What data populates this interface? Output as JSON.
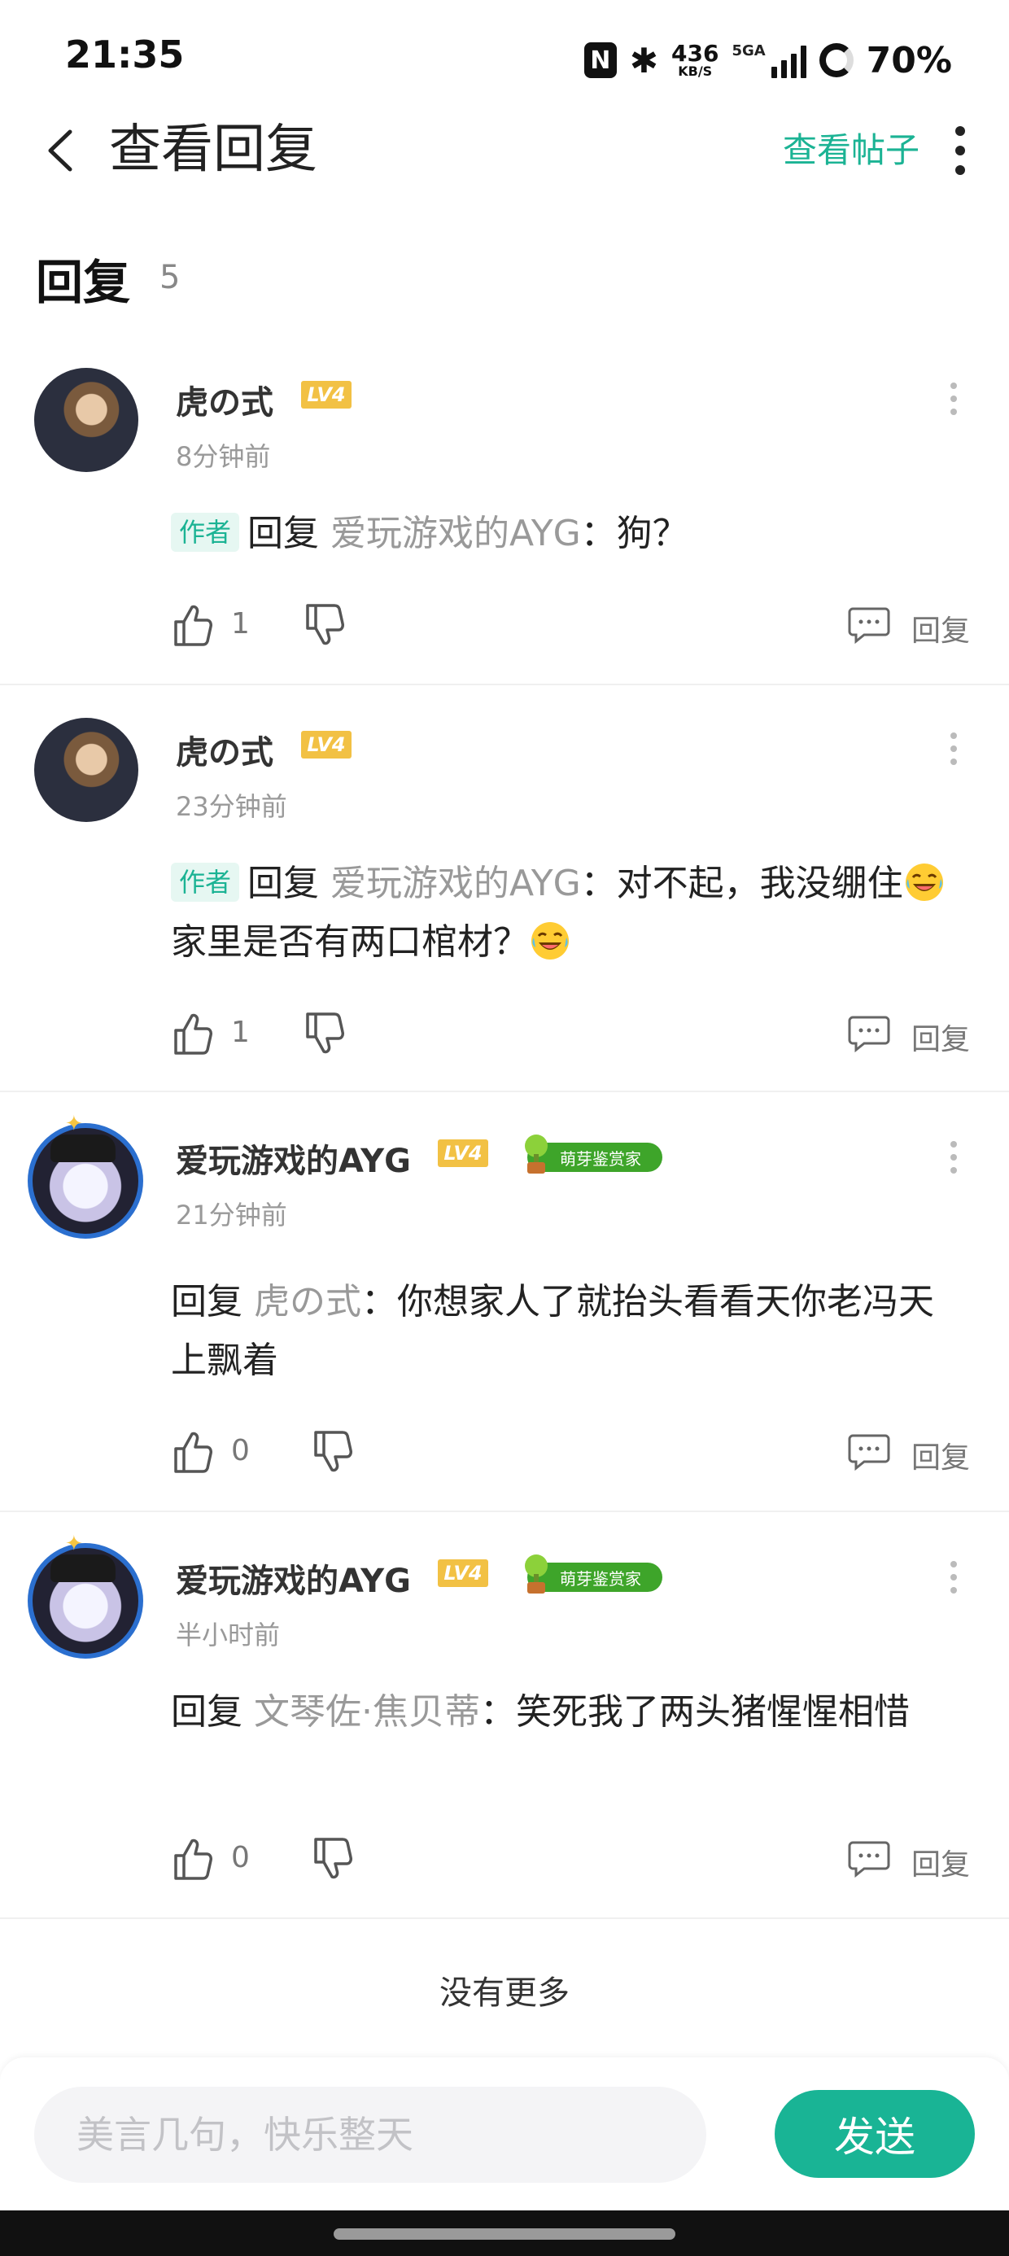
{
  "status_bar": {
    "time": "21:35",
    "nfc_icon": "N",
    "speed_value": "436",
    "speed_unit": "KB/S",
    "network": "5GA",
    "battery": "70%"
  },
  "header": {
    "title": "查看回复",
    "view_post": "查看帖子"
  },
  "section": {
    "title": "回复",
    "count": "5"
  },
  "replies": [
    {
      "username": "虎の式",
      "level": "LV4",
      "time": "8分钟前",
      "author_tag": "作者",
      "reply_word": "回复",
      "reply_to": "爱玩游戏的AYG",
      "text": "：狗？",
      "likes": "1",
      "reply_label": "回复"
    },
    {
      "username": "虎の式",
      "level": "LV4",
      "time": "23分钟前",
      "author_tag": "作者",
      "reply_word": "回复",
      "reply_to": "爱玩游戏的AYG",
      "text_a": "：对不起，我没绷住",
      "text_b": "家里是否有两口棺材？",
      "likes": "1",
      "reply_label": "回复"
    },
    {
      "username": "爱玩游戏的AYG",
      "level": "LV4",
      "badge": "萌芽鉴赏家",
      "time": "21分钟前",
      "reply_word": "回复",
      "reply_to": "虎の式",
      "text": "：你想家人了就抬头看看天你老冯天上飘着",
      "likes": "0",
      "reply_label": "回复"
    },
    {
      "username": "爱玩游戏的AYG",
      "level": "LV4",
      "badge": "萌芽鉴赏家",
      "time": "半小时前",
      "reply_word": "回复",
      "reply_to": "文琴佐·焦贝蒂",
      "text": "：笑死我了两头猪惺惺相惜",
      "likes": "0",
      "reply_label": "回复"
    }
  ],
  "footer": {
    "no_more": "没有更多",
    "input_placeholder": "美言几句，快乐整天",
    "send": "发送"
  },
  "colors": {
    "accent": "#1bb394",
    "level_badge": "#f2c144",
    "sprout_badge": "#3ea52a"
  },
  "icons": [
    "back-arrow-icon",
    "more-vertical-icon",
    "thumb-up-icon",
    "thumb-down-icon",
    "comment-icon",
    "laughing-emoji"
  ]
}
